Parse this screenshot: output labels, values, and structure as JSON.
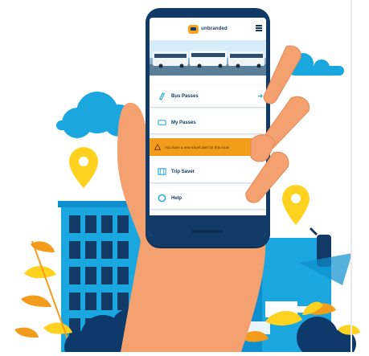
{
  "app": {
    "logo_text": "unbranded"
  },
  "menu": {
    "items": [
      {
        "label": "Bus Passes",
        "icon": "bus-pass-icon"
      },
      {
        "label": "My Passes",
        "icon": "ticket-icon"
      },
      {
        "label": "Trip Saver",
        "icon": "map-icon"
      },
      {
        "label": "Help",
        "icon": "help-icon"
      }
    ],
    "alert_text": "You have a new travel alert for this route"
  },
  "colors": {
    "navy": "#123a66",
    "orange": "#f39c1c",
    "skin": "#f4a06f",
    "sky_blue": "#1aa7e0",
    "yellow": "#ffd21f"
  }
}
